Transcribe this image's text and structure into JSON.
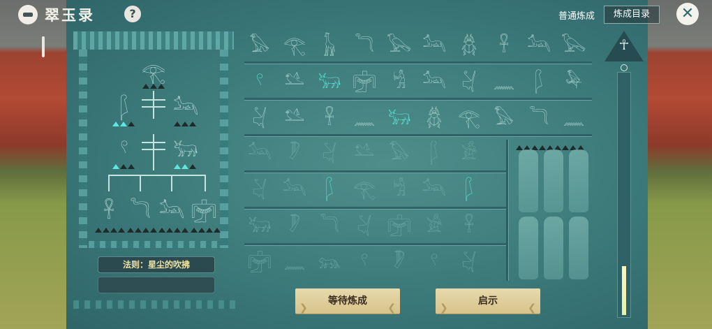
{
  "header": {
    "title": "翠玉录",
    "help_label": "?",
    "mode_normal": "普通炼成",
    "mode_catalog": "炼成目录",
    "close_label": "✕"
  },
  "recipe": {
    "top_glyph": "𓂀",
    "left_glyph": "𓆄",
    "right_glyph": "𓃢",
    "left2_glyph": "𓍢",
    "right2_glyph": "𓃒",
    "bottom_glyphs": [
      "𓋹",
      "𓆓",
      "𓃢",
      "𓋟"
    ],
    "rule_label": "法则：星尘的吹拂"
  },
  "grid": {
    "rows": [
      [
        "𓅃",
        "𓂀",
        "𓃱",
        "𓆓",
        "𓅂",
        "𓃢",
        "𓆣",
        "𓋹",
        "𓃢",
        "𓅂"
      ],
      [
        "𓍢",
        "𓅎",
        "𓃒",
        "𓋟",
        "𓀜",
        "𓃢",
        "𓋔",
        "𓈖",
        "𓆄",
        "𓅆"
      ],
      [
        "𓋔",
        "𓅎",
        "𓋹",
        "𓈖",
        "𓃒",
        "𓆣",
        "𓂀",
        "𓅃",
        "𓆓",
        "𓈖"
      ],
      [
        "𓃢",
        "𓏢",
        "𓋔",
        "𓅎",
        "𓅃",
        "𓆄",
        "𓀀"
      ],
      [
        "𓋔",
        "𓃢",
        "𓆄",
        "𓂀",
        "𓀜",
        "𓃢",
        "𓆄"
      ],
      [
        "𓃒",
        "𓏢",
        "𓆓",
        "𓋔",
        "𓋟",
        "𓀀",
        "𓋹"
      ],
      [
        "𓋟",
        "𓈖",
        "𓃬",
        "𓍢",
        "𓏢",
        "𓍢",
        "𓋔"
      ]
    ]
  },
  "meter": {
    "ankh": "☥",
    "fill_fraction": 0.2
  },
  "buttons": {
    "wait_label": "等待炼成",
    "hint_label": "启示"
  }
}
